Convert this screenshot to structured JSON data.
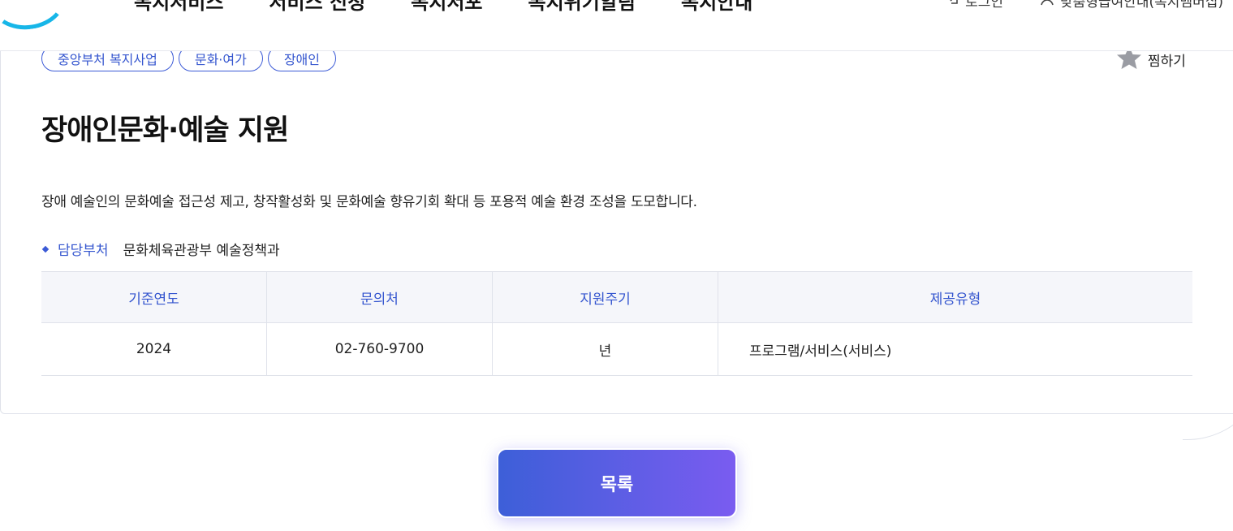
{
  "header": {
    "nav": [
      "복지서비스",
      "서비스 신청",
      "복지서포",
      "복지위기알림",
      "복지안내"
    ],
    "login_label": "로그인",
    "account_label": "맞춤형급여안내(복지멤버십)"
  },
  "service": {
    "tags": [
      "중앙부처 복지사업",
      "문화·여가",
      "장애인"
    ],
    "favorite_label": "찜하기",
    "title": "장애인문화·예술 지원",
    "description": "장애 예술인의 문화예술 접근성 제고, 창작활성화 및 문화예술 향유기회 확대 등 포용적 예술 환경 조성을 도모합니다.",
    "department_label": "담당부처",
    "department_value": "문화체육관광부 예술정책과",
    "table": {
      "headers": [
        "기준연도",
        "문의처",
        "지원주기",
        "제공유형"
      ],
      "row": [
        "2024",
        "02-760-9700",
        "년",
        "프로그램/서비스(서비스)"
      ]
    }
  },
  "list_button_label": "목록",
  "colors": {
    "accent": "#3556cf",
    "button_start": "#3d5fd8",
    "button_end": "#7a5cf0",
    "logo": "#17b6e8"
  }
}
